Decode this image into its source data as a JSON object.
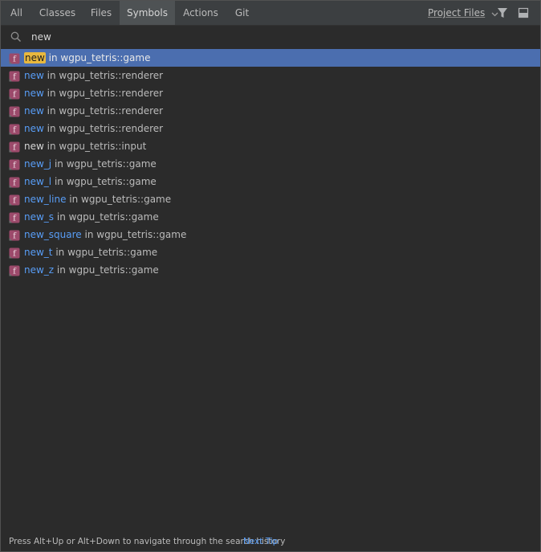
{
  "tabs": [
    {
      "label": "All",
      "active": false
    },
    {
      "label": "Classes",
      "active": false
    },
    {
      "label": "Files",
      "active": false
    },
    {
      "label": "Symbols",
      "active": true
    },
    {
      "label": "Actions",
      "active": false
    },
    {
      "label": "Git",
      "active": false
    }
  ],
  "toolbar": {
    "scope_label": "Project Files",
    "icons": [
      "chevron-down-icon",
      "filter-icon",
      "preview-icon"
    ]
  },
  "search": {
    "value": "new",
    "icon": "search-icon"
  },
  "results": [
    {
      "name": "new",
      "location": " in wgpu_tetris::game",
      "selected": true,
      "plain": false
    },
    {
      "name": "new",
      "location": " in wgpu_tetris::renderer",
      "selected": false,
      "plain": false
    },
    {
      "name": "new",
      "location": " in wgpu_tetris::renderer",
      "selected": false,
      "plain": false
    },
    {
      "name": "new",
      "location": " in wgpu_tetris::renderer",
      "selected": false,
      "plain": false
    },
    {
      "name": "new",
      "location": " in wgpu_tetris::renderer",
      "selected": false,
      "plain": false
    },
    {
      "name": "new",
      "location": " in wgpu_tetris::input",
      "selected": false,
      "plain": true
    },
    {
      "name": "new_j",
      "location": " in wgpu_tetris::game",
      "selected": false,
      "plain": false
    },
    {
      "name": "new_l",
      "location": " in wgpu_tetris::game",
      "selected": false,
      "plain": false
    },
    {
      "name": "new_line",
      "location": " in wgpu_tetris::game",
      "selected": false,
      "plain": false
    },
    {
      "name": "new_s",
      "location": " in wgpu_tetris::game",
      "selected": false,
      "plain": false
    },
    {
      "name": "new_square",
      "location": " in wgpu_tetris::game",
      "selected": false,
      "plain": false
    },
    {
      "name": "new_t",
      "location": " in wgpu_tetris::game",
      "selected": false,
      "plain": false
    },
    {
      "name": "new_z",
      "location": " in wgpu_tetris::game",
      "selected": false,
      "plain": false
    }
  ],
  "result_icon": {
    "glyph": "f",
    "name": "function-icon",
    "color": "#9c4a6b"
  },
  "footer": {
    "hint": "Press Alt+Up or Alt+Down to navigate through the search history",
    "link": "Next Tip"
  },
  "colors": {
    "selection": "#4b6eaf",
    "match_highlight": "#e8b83e",
    "link": "#589df6"
  }
}
